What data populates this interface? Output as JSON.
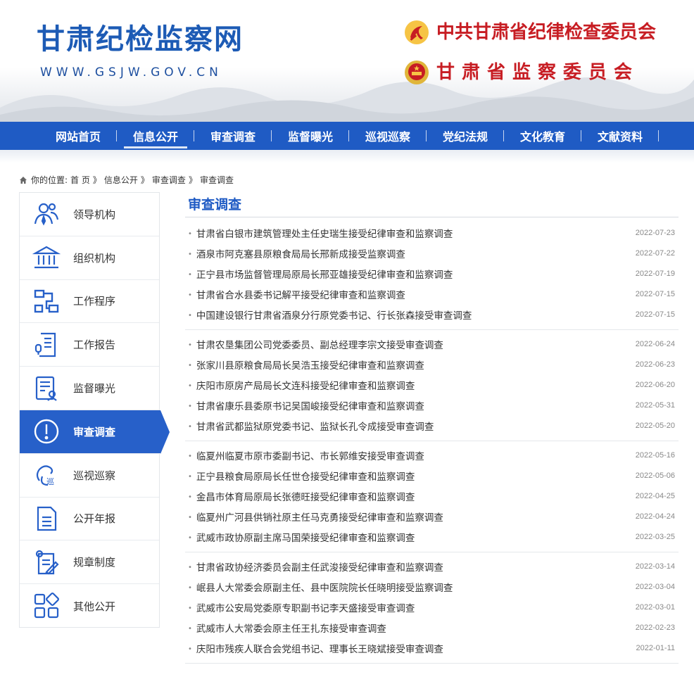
{
  "header": {
    "site_title": "甘肃纪检监察网",
    "site_url": "WWW.GSJW.GOV.CN",
    "org1": "中共甘肃省纪律检查委员会",
    "org2": "甘肃省监察委员会"
  },
  "nav": {
    "items": [
      "网站首页",
      "信息公开",
      "审查调查",
      "监督曝光",
      "巡视巡察",
      "党纪法规",
      "文化教育",
      "文献资料"
    ],
    "active_index": 1
  },
  "breadcrumb": {
    "label": "你的位置:",
    "items": [
      "首 页",
      "》",
      "信息公开",
      "》",
      "审查调查",
      "》",
      "审查调查"
    ]
  },
  "sidebar": {
    "items": [
      {
        "label": "领导机构",
        "icon": "leaders-icon"
      },
      {
        "label": "组织机构",
        "icon": "institution-icon"
      },
      {
        "label": "工作程序",
        "icon": "workflow-icon"
      },
      {
        "label": "工作报告",
        "icon": "report-icon"
      },
      {
        "label": "监督曝光",
        "icon": "supervision-icon"
      },
      {
        "label": "审查调查",
        "icon": "alert-icon"
      },
      {
        "label": "巡视巡察",
        "icon": "inspection-icon"
      },
      {
        "label": "公开年报",
        "icon": "document-icon"
      },
      {
        "label": "规章制度",
        "icon": "rules-icon"
      },
      {
        "label": "其他公开",
        "icon": "grid-icon"
      }
    ],
    "active_index": 5
  },
  "content": {
    "title": "审查调查",
    "groups": [
      [
        {
          "title": "甘肃省白银市建筑管理处主任史瑞生接受纪律审查和监察调查",
          "date": "2022-07-23"
        },
        {
          "title": "酒泉市阿克塞县原粮食局局长邢新成接受监察调查",
          "date": "2022-07-22"
        },
        {
          "title": "正宁县市场监督管理局原局长邢亚雄接受纪律审查和监察调查",
          "date": "2022-07-19"
        },
        {
          "title": "甘肃省合水县委书记解平接受纪律审查和监察调查",
          "date": "2022-07-15"
        },
        {
          "title": "中国建设银行甘肃省酒泉分行原党委书记、行长张森接受审查调查",
          "date": "2022-07-15"
        }
      ],
      [
        {
          "title": "甘肃农垦集团公司党委委员、副总经理李宗文接受审查调查",
          "date": "2022-06-24"
        },
        {
          "title": "张家川县原粮食局局长吴浩玉接受纪律审查和监察调查",
          "date": "2022-06-23"
        },
        {
          "title": "庆阳市原房产局局长文连科接受纪律审查和监察调查",
          "date": "2022-06-20"
        },
        {
          "title": "甘肃省康乐县委原书记吴国峻接受纪律审查和监察调查",
          "date": "2022-05-31"
        },
        {
          "title": "甘肃省武都监狱原党委书记、监狱长孔令成接受审查调查",
          "date": "2022-05-20"
        }
      ],
      [
        {
          "title": "临夏州临夏市原市委副书记、市长郭维安接受审查调查",
          "date": "2022-05-16"
        },
        {
          "title": "正宁县粮食局原局长任世仓接受纪律审查和监察调查",
          "date": "2022-05-06"
        },
        {
          "title": "金昌市体育局原局长张德旺接受纪律审查和监察调查",
          "date": "2022-04-25"
        },
        {
          "title": "临夏州广河县供销社原主任马克勇接受纪律审查和监察调查",
          "date": "2022-04-24"
        },
        {
          "title": "武威市政协原副主席马国荣接受纪律审查和监察调查",
          "date": "2022-03-25"
        }
      ],
      [
        {
          "title": "甘肃省政协经济委员会副主任武浚接受纪律审查和监察调查",
          "date": "2022-03-14"
        },
        {
          "title": "岷县人大常委会原副主任、县中医院院长任晓明接受监察调查",
          "date": "2022-03-04"
        },
        {
          "title": "武威市公安局党委原专职副书记李天盛接受审查调查",
          "date": "2022-03-01"
        },
        {
          "title": "武威市人大常委会原主任王扎东接受审查调查",
          "date": "2022-02-23"
        },
        {
          "title": "庆阳市残疾人联合会党组书记、理事长王晓斌接受审查调查",
          "date": "2022-01-11"
        }
      ]
    ]
  },
  "colors": {
    "primary_blue": "#1f5bc4",
    "brand_red": "#c71d23",
    "title_blue": "#1d5bb5"
  }
}
